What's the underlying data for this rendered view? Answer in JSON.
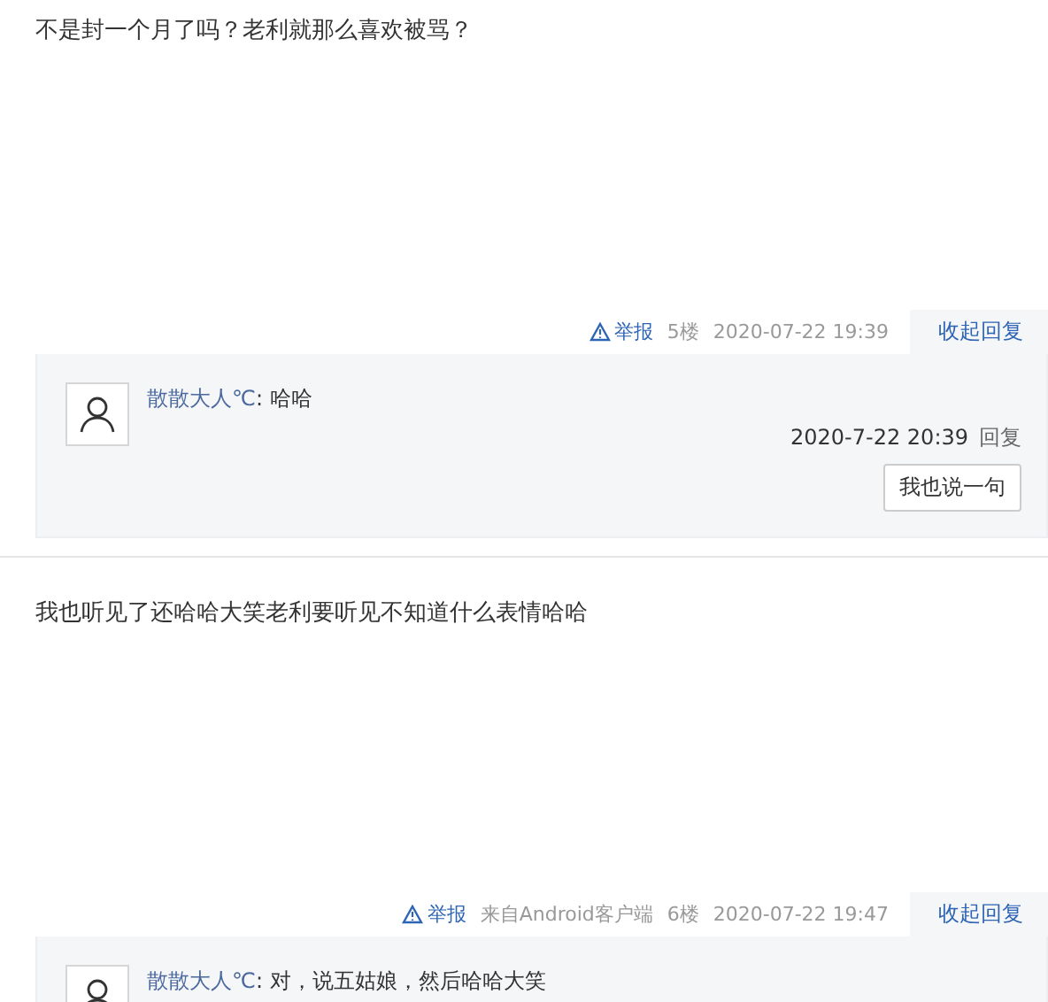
{
  "posts": [
    {
      "content": "不是封一个月了吗？老利就那么喜欢被骂？",
      "report": "举报",
      "floor": "5楼",
      "time": "2020-07-22 19:39",
      "collapse": "收起回复",
      "replies": [
        {
          "author": "散散大人℃",
          "text": ": 哈哈",
          "time": "2020-7-22 20:39",
          "reply": "回复"
        }
      ],
      "reply_button": "我也说一句"
    },
    {
      "content": "我也听见了还哈哈大笑老利要听见不知道什么表情哈哈",
      "report": "举报",
      "source": "来自Android客户端",
      "floor": "6楼",
      "time": "2020-07-22 19:47",
      "collapse": "收起回复",
      "replies": [
        {
          "author": "散散大人℃",
          "text": ": 对，说五姑娘，然后哈哈大笑"
        }
      ]
    }
  ]
}
